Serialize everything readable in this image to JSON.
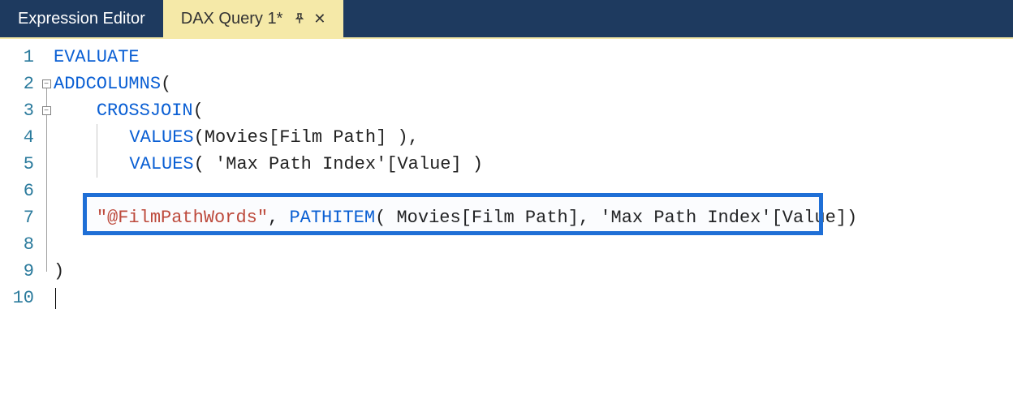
{
  "tabs": {
    "expression_editor": "Expression Editor",
    "dax_query": "DAX Query 1*"
  },
  "gutter": [
    "1",
    "2",
    "3",
    "4",
    "5",
    "6",
    "7",
    "8",
    "9",
    "10"
  ],
  "code": {
    "l1": {
      "kw": "EVALUATE"
    },
    "l2": {
      "kw": "ADDCOLUMNS",
      "p": "("
    },
    "l3": {
      "kw": "CROSSJOIN",
      "p": "("
    },
    "l4": {
      "kw": "VALUES",
      "po": "(",
      "arg": "Movies[Film Path] ",
      "pc": ")",
      "comma": ","
    },
    "l5": {
      "kw": "VALUES",
      "po": "( ",
      "arg": "'Max Path Index'[Value] ",
      "pc": ")"
    },
    "l7": {
      "str": "\"@FilmPathWords\"",
      "comma": ", ",
      "kw": "PATHITEM",
      "po": "( ",
      "arg1": "Movies[Film Path]",
      "mid": ", ",
      "arg2": "'Max Path Index'[Value]",
      "pc": ")"
    },
    "l9": {
      "p": ")"
    }
  }
}
